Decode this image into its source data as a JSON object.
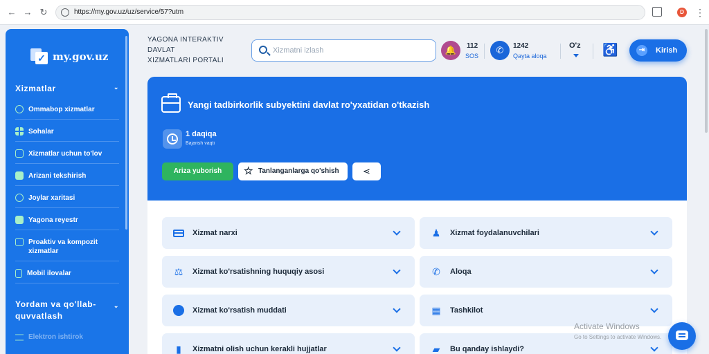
{
  "browser": {
    "url": "https://my.gov.uz/uz/service/57?utm",
    "profile_initial": "D"
  },
  "sidebar": {
    "logo_text": "my.gov.uz",
    "section1": "Xizmatlar",
    "items": [
      {
        "label": "Ommabop xizmatlar",
        "icon": "check-badge-icon"
      },
      {
        "label": "Sohalar",
        "icon": "grid-icon"
      },
      {
        "label": "Xizmatlar uchun to'lov",
        "icon": "card-icon"
      },
      {
        "label": "Arizani tekshirish",
        "icon": "document-icon"
      },
      {
        "label": "Joylar xaritasi",
        "icon": "map-pin-icon"
      },
      {
        "label": "Yagona reyestr",
        "icon": "file-icon"
      },
      {
        "label": "Proaktiv va kompozit xizmatlar",
        "icon": "file-check-icon"
      },
      {
        "label": "Mobil ilovalar",
        "icon": "phone-icon"
      }
    ],
    "section2": "Yordam va qo'llab-quvvatlash",
    "faded_item": "Elektron ishtirok"
  },
  "header": {
    "portal_title": [
      "YAGONA INTERAKTIV",
      "DAVLAT",
      "XIZMATLARI PORTALI"
    ],
    "search_placeholder": "Xizmatni izlash",
    "sos_number": "112",
    "sos_label": "SOS",
    "callback_number": "1242",
    "callback_label": "Qayta aloqa",
    "language": "O'z",
    "login_label": "Kirish"
  },
  "service": {
    "title": "Yangi tadbirkorlik subyektini davlat ro'yxatidan o'tkazish",
    "duration": "1 daqiqa",
    "duration_label": "Bajarish vaqti",
    "apply_button": "Ariza yuborish",
    "favorite_button": "Tanlanganlarga qo'shish"
  },
  "accordion": [
    {
      "label": "Xizmat narxi",
      "icon": "card-icon"
    },
    {
      "label": "Xizmat foydalanuvchilari",
      "icon": "person-icon"
    },
    {
      "label": "Xizmat ko'rsatishning huquqiy asosi",
      "icon": "scales-icon"
    },
    {
      "label": "Aloqa",
      "icon": "phone-icon"
    },
    {
      "label": "Xizmat ko'rsatish muddati",
      "icon": "clock-icon"
    },
    {
      "label": "Tashkilot",
      "icon": "building-icon"
    },
    {
      "label": "Xizmatni olish uchun kerakli hujjatlar",
      "icon": "document-icon"
    },
    {
      "label": "Bu qanday ishlaydi?",
      "icon": "chat-icon"
    }
  ],
  "watermark": {
    "line1": "Activate Windows",
    "line2": "Go to Settings to activate Windows."
  },
  "colors": {
    "brand_blue": "#1a6fe6",
    "sidebar_blue": "#1a75e8",
    "apply_green": "#2fb45f",
    "accordion_bg": "#e8f0fb"
  }
}
